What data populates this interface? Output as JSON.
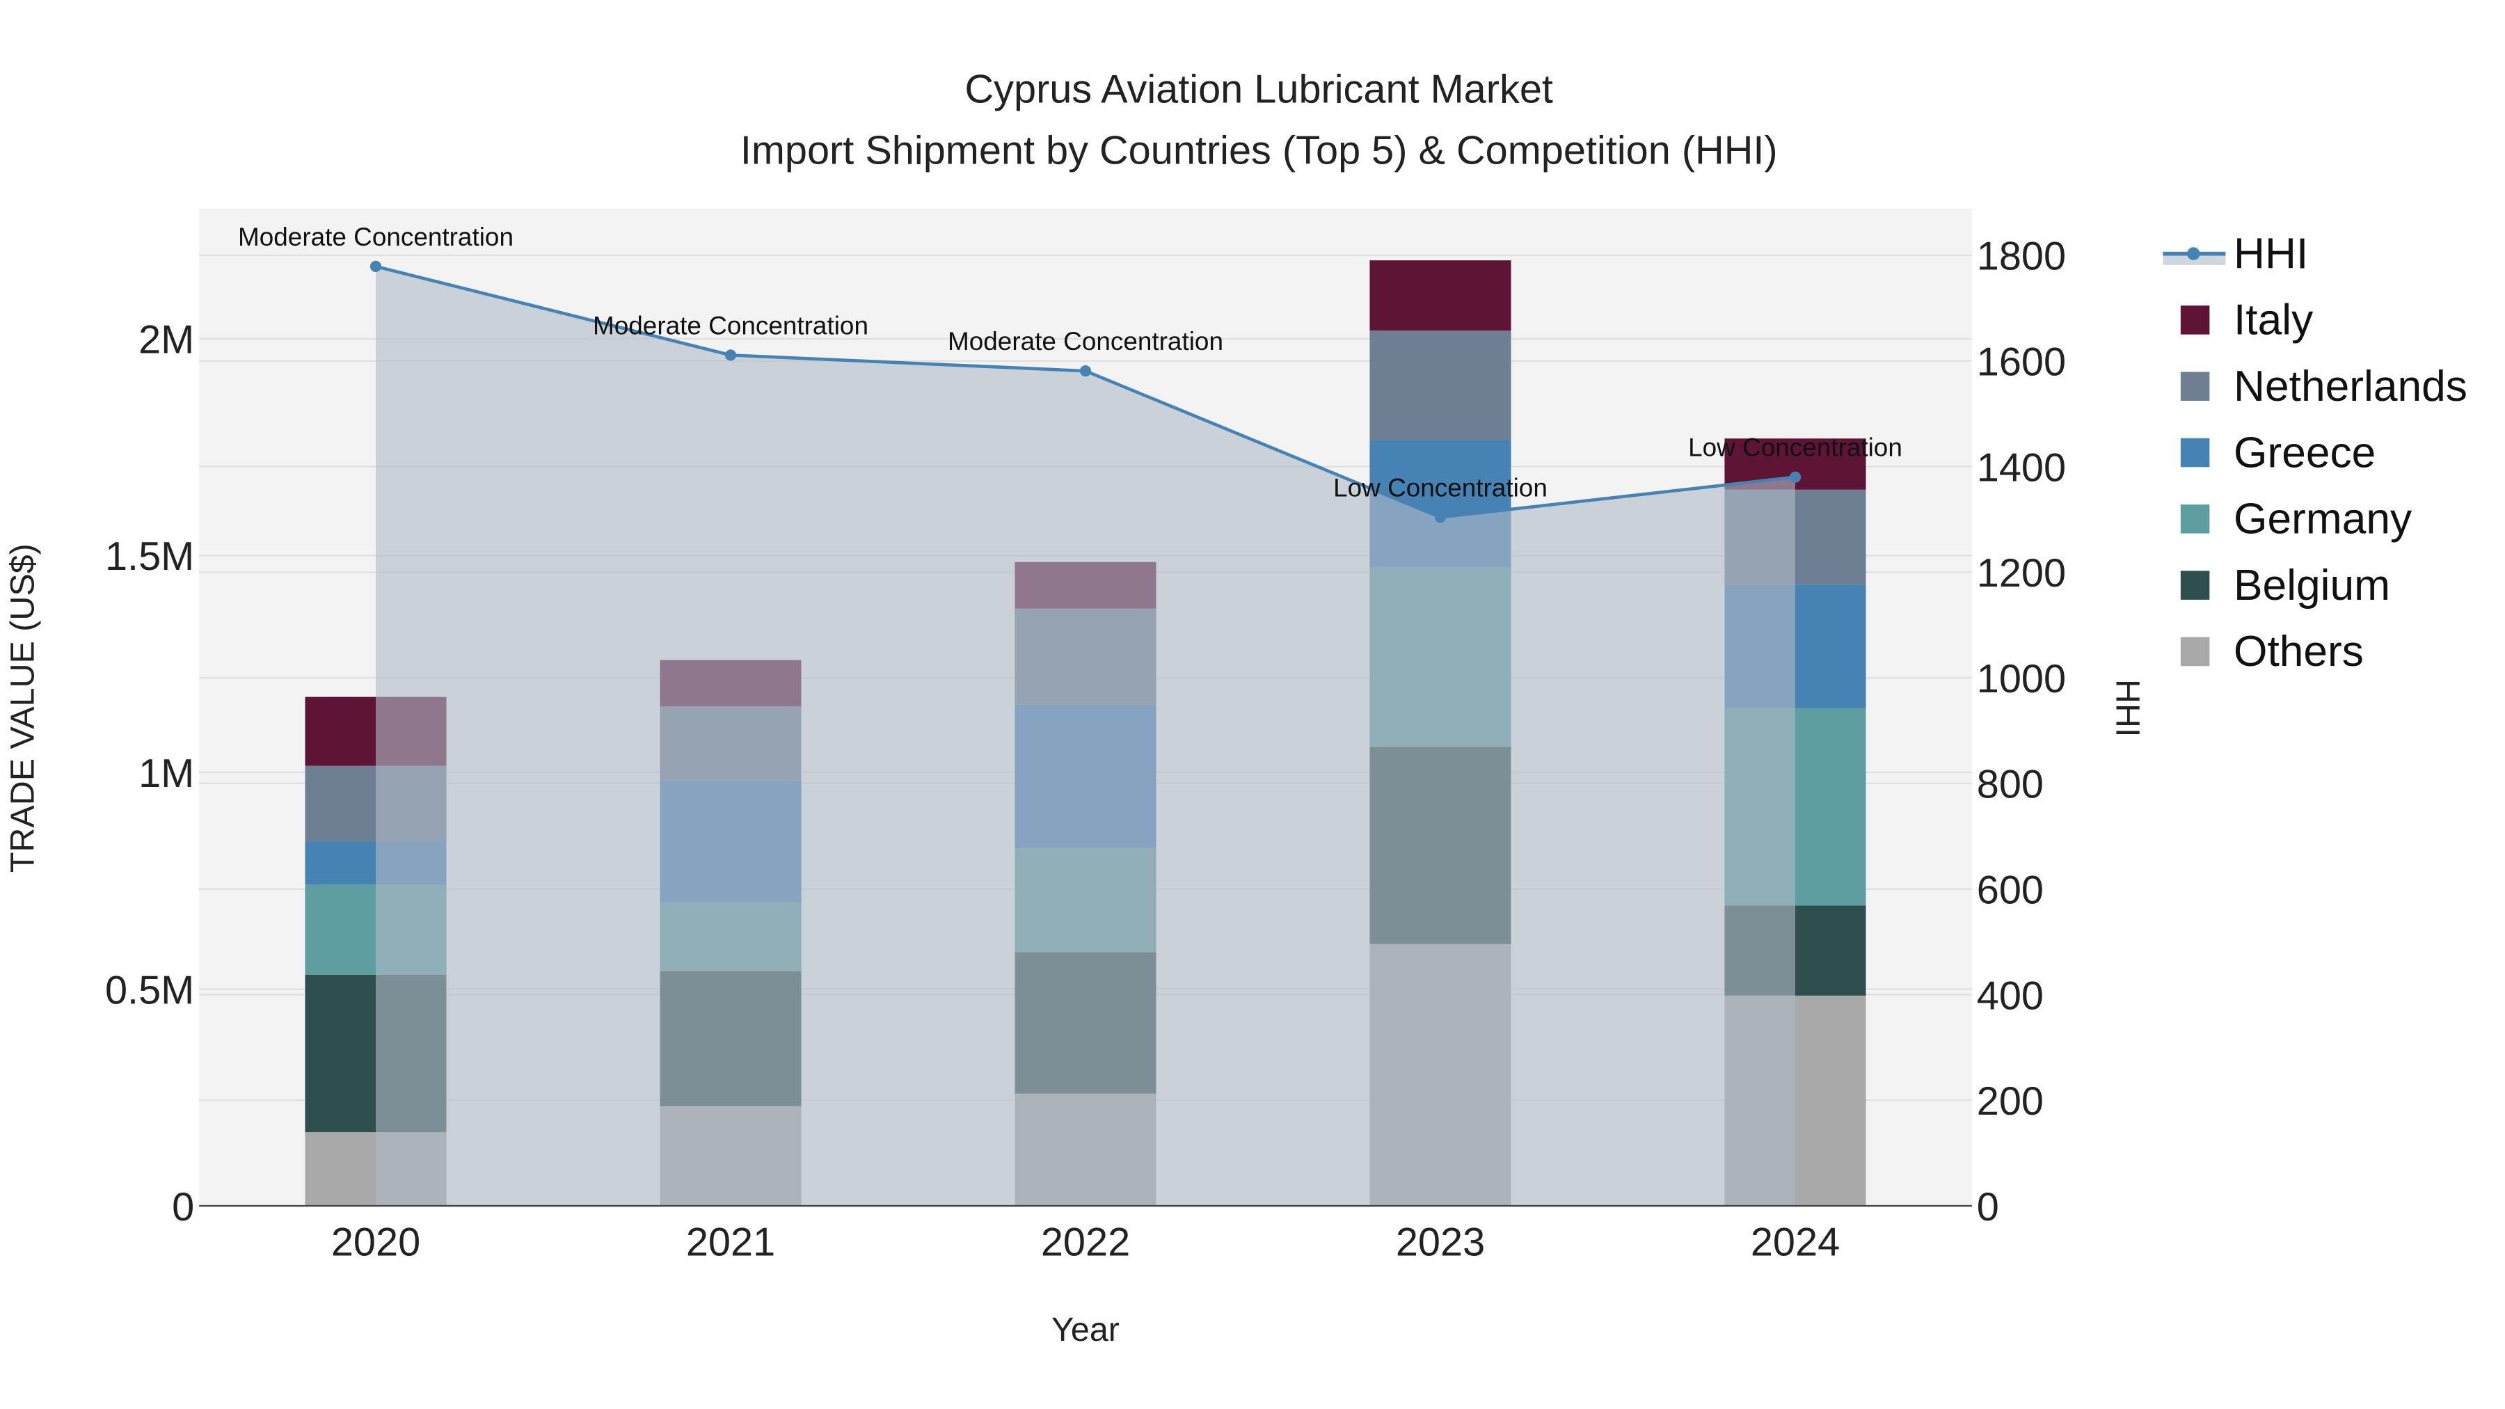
{
  "chart_data": {
    "type": "bar",
    "title": "Cyprus Aviation Lubricant Market",
    "subtitle": "Import Shipment by Countries (Top 5) & Competition (HHI)",
    "xlabel": "Year",
    "ylabel": "TRADE VALUE (US$)",
    "y2label": "HHI",
    "categories": [
      "2020",
      "2021",
      "2022",
      "2023",
      "2024"
    ],
    "ylim": [
      0,
      2300000
    ],
    "y2lim": [
      0,
      1880
    ],
    "yticks": [
      {
        "v": 0,
        "label": "0"
      },
      {
        "v": 500000,
        "label": "0.5M"
      },
      {
        "v": 1000000,
        "label": "1M"
      },
      {
        "v": 1500000,
        "label": "1.5M"
      },
      {
        "v": 2000000,
        "label": "2M"
      }
    ],
    "y2ticks": [
      0,
      200,
      400,
      600,
      800,
      1000,
      1200,
      1400,
      1600,
      1800
    ],
    "stacked": true,
    "series": [
      {
        "name": "Others",
        "color": "#a9a9a9",
        "values": [
          170000,
          230000,
          259000,
          604000,
          485000
        ]
      },
      {
        "name": "Belgium",
        "color": "#2f4f4f",
        "values": [
          363000,
          311000,
          326000,
          455000,
          208000
        ]
      },
      {
        "name": "Germany",
        "color": "#5f9ea0",
        "values": [
          208000,
          159000,
          241000,
          415000,
          455000
        ]
      },
      {
        "name": "Greece",
        "color": "#4682b4",
        "values": [
          100000,
          281000,
          330000,
          293000,
          285000
        ]
      },
      {
        "name": "Netherlands",
        "color": "#6e7f93",
        "values": [
          174000,
          171000,
          222000,
          252000,
          219000
        ]
      },
      {
        "name": "Italy",
        "color": "#5e1535",
        "values": [
          159000,
          107000,
          107000,
          162000,
          118000
        ]
      }
    ],
    "line": {
      "name": "HHI",
      "axis": "right",
      "color": "#4682b4",
      "values": [
        1779,
        1611,
        1581,
        1304,
        1380
      ],
      "annotations": [
        "Moderate Concentration",
        "Moderate Concentration",
        "Moderate Concentration",
        "Low Concentration",
        "Low Concentration"
      ]
    },
    "legend": [
      "HHI",
      "Italy",
      "Netherlands",
      "Greece",
      "Germany",
      "Belgium",
      "Others"
    ],
    "legend_position": "right",
    "grid": true
  }
}
